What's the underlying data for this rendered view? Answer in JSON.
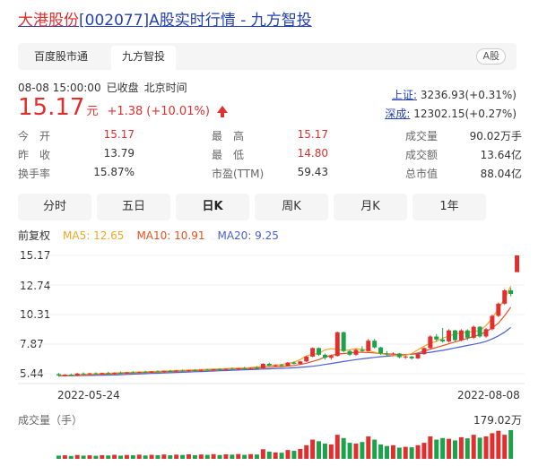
{
  "title": {
    "name": "大港股份",
    "code": "[002077]",
    "suffix": "A股实时行情 - 九方智投"
  },
  "tabs": [
    {
      "label": "百度股市通",
      "active": false
    },
    {
      "label": "九方智投",
      "active": true
    }
  ],
  "market_badge": "A股",
  "status": {
    "datetime": "08-08 15:00:00",
    "state": "已收盘",
    "timezone": "北京时间"
  },
  "quote": {
    "price": "15.17",
    "unit": "元",
    "change": "+1.38",
    "change_pct": "(+10.01%)",
    "direction": "up"
  },
  "indices": [
    {
      "name": "上证:",
      "value": "3236.93(+0.31%)"
    },
    {
      "name": "深成:",
      "value": "12302.15(+0.27%)"
    }
  ],
  "stats": [
    {
      "label": "今　开",
      "value": "15.17",
      "color": "red"
    },
    {
      "label": "最　高",
      "value": "15.17",
      "color": "red"
    },
    {
      "label": "成交量",
      "value": "90.02万手",
      "color": "normal"
    },
    {
      "label": "昨　收",
      "value": "13.79",
      "color": "normal"
    },
    {
      "label": "最　低",
      "value": "14.80",
      "color": "red"
    },
    {
      "label": "成交额",
      "value": "13.64亿",
      "color": "normal"
    },
    {
      "label": "换手率",
      "value": "15.87%",
      "color": "normal"
    },
    {
      "label": "市盈(TTM)",
      "value": "59.43",
      "color": "normal"
    },
    {
      "label": "总市值",
      "value": "88.04亿",
      "color": "normal"
    }
  ],
  "period_tabs": [
    {
      "label": "分时",
      "active": false
    },
    {
      "label": "五日",
      "active": false
    },
    {
      "label": "日K",
      "active": true
    },
    {
      "label": "周K",
      "active": false
    },
    {
      "label": "月K",
      "active": false
    },
    {
      "label": "1年",
      "active": false
    }
  ],
  "legend": {
    "adjust": "前复权",
    "ma5": "MA5: 12.65",
    "ma10": "MA10: 10.91",
    "ma20": "MA20: 9.25"
  },
  "colors": {
    "up": "#e12e2e",
    "down": "#1aa34a",
    "ma5": "#f5a623",
    "ma10": "#e8501e",
    "ma20": "#4a5fd8",
    "link": "#2440b3"
  },
  "chart_data": {
    "type": "candlestick",
    "y_ticks": [
      "15.17",
      "12.74",
      "10.31",
      "7.87",
      "5.44"
    ],
    "ylim": [
      5.44,
      15.17
    ],
    "x_labels": [
      "2022-05-24",
      "2022-08-08"
    ],
    "volume_label": "成交量（手）",
    "volume_max_label": "179.02万",
    "candles": [
      {
        "o": 5.4,
        "h": 5.5,
        "l": 5.2,
        "c": 5.3
      },
      {
        "o": 5.3,
        "h": 5.4,
        "l": 5.2,
        "c": 5.35
      },
      {
        "o": 5.35,
        "h": 5.45,
        "l": 5.25,
        "c": 5.3
      },
      {
        "o": 5.3,
        "h": 5.5,
        "l": 5.25,
        "c": 5.45
      },
      {
        "o": 5.45,
        "h": 5.55,
        "l": 5.35,
        "c": 5.4
      },
      {
        "o": 5.4,
        "h": 5.5,
        "l": 5.3,
        "c": 5.48
      },
      {
        "o": 5.48,
        "h": 5.55,
        "l": 5.38,
        "c": 5.42
      },
      {
        "o": 5.42,
        "h": 5.52,
        "l": 5.35,
        "c": 5.5
      },
      {
        "o": 5.5,
        "h": 5.6,
        "l": 5.42,
        "c": 5.45
      },
      {
        "o": 5.45,
        "h": 5.55,
        "l": 5.38,
        "c": 5.52
      },
      {
        "o": 5.52,
        "h": 5.62,
        "l": 5.45,
        "c": 5.48
      },
      {
        "o": 5.48,
        "h": 5.58,
        "l": 5.4,
        "c": 5.55
      },
      {
        "o": 5.55,
        "h": 5.65,
        "l": 5.48,
        "c": 5.5
      },
      {
        "o": 5.5,
        "h": 5.6,
        "l": 5.45,
        "c": 5.58
      },
      {
        "o": 5.58,
        "h": 5.68,
        "l": 5.5,
        "c": 5.55
      },
      {
        "o": 5.55,
        "h": 5.65,
        "l": 5.48,
        "c": 5.62
      },
      {
        "o": 5.62,
        "h": 5.72,
        "l": 5.55,
        "c": 5.58
      },
      {
        "o": 5.58,
        "h": 5.7,
        "l": 5.52,
        "c": 5.66
      },
      {
        "o": 5.66,
        "h": 5.75,
        "l": 5.58,
        "c": 5.62
      },
      {
        "o": 5.62,
        "h": 5.74,
        "l": 5.55,
        "c": 5.7
      },
      {
        "o": 5.7,
        "h": 5.78,
        "l": 5.6,
        "c": 5.65
      },
      {
        "o": 5.65,
        "h": 5.75,
        "l": 5.58,
        "c": 5.72
      },
      {
        "o": 5.72,
        "h": 5.8,
        "l": 5.64,
        "c": 5.68
      },
      {
        "o": 5.68,
        "h": 5.8,
        "l": 5.62,
        "c": 5.76
      },
      {
        "o": 5.76,
        "h": 5.85,
        "l": 5.68,
        "c": 5.72
      },
      {
        "o": 5.72,
        "h": 5.84,
        "l": 5.66,
        "c": 5.8
      },
      {
        "o": 5.8,
        "h": 5.9,
        "l": 5.72,
        "c": 5.76
      },
      {
        "o": 5.76,
        "h": 5.88,
        "l": 5.7,
        "c": 5.84
      },
      {
        "o": 5.84,
        "h": 5.95,
        "l": 5.76,
        "c": 5.8
      },
      {
        "o": 5.8,
        "h": 5.92,
        "l": 5.74,
        "c": 5.88
      },
      {
        "o": 5.88,
        "h": 6.0,
        "l": 5.8,
        "c": 5.84
      },
      {
        "o": 5.84,
        "h": 5.96,
        "l": 5.78,
        "c": 5.92
      },
      {
        "o": 5.92,
        "h": 6.05,
        "l": 5.85,
        "c": 5.88
      },
      {
        "o": 5.88,
        "h": 6.3,
        "l": 5.85,
        "c": 6.25
      },
      {
        "o": 6.25,
        "h": 6.35,
        "l": 6.05,
        "c": 6.1
      },
      {
        "o": 6.1,
        "h": 6.2,
        "l": 6.0,
        "c": 6.15
      },
      {
        "o": 6.15,
        "h": 6.25,
        "l": 6.05,
        "c": 6.1
      },
      {
        "o": 6.1,
        "h": 6.4,
        "l": 6.05,
        "c": 6.35
      },
      {
        "o": 6.35,
        "h": 6.45,
        "l": 6.2,
        "c": 6.25
      },
      {
        "o": 6.25,
        "h": 6.5,
        "l": 6.2,
        "c": 6.45
      },
      {
        "o": 6.45,
        "h": 6.9,
        "l": 6.4,
        "c": 6.85
      },
      {
        "o": 6.85,
        "h": 7.6,
        "l": 6.8,
        "c": 7.55
      },
      {
        "o": 7.55,
        "h": 7.6,
        "l": 6.9,
        "c": 7.0
      },
      {
        "o": 7.0,
        "h": 7.1,
        "l": 6.6,
        "c": 6.75
      },
      {
        "o": 6.75,
        "h": 7.0,
        "l": 6.6,
        "c": 6.9
      },
      {
        "o": 6.9,
        "h": 8.9,
        "l": 6.85,
        "c": 8.85
      },
      {
        "o": 8.85,
        "h": 8.9,
        "l": 7.2,
        "c": 7.3
      },
      {
        "o": 7.3,
        "h": 7.4,
        "l": 6.9,
        "c": 7.0
      },
      {
        "o": 7.0,
        "h": 7.5,
        "l": 6.9,
        "c": 7.4
      },
      {
        "o": 7.4,
        "h": 7.7,
        "l": 7.2,
        "c": 7.3
      },
      {
        "o": 7.3,
        "h": 8.3,
        "l": 7.25,
        "c": 8.15
      },
      {
        "o": 8.15,
        "h": 8.3,
        "l": 7.5,
        "c": 7.6
      },
      {
        "o": 7.6,
        "h": 7.65,
        "l": 7.0,
        "c": 7.1
      },
      {
        "o": 7.1,
        "h": 7.3,
        "l": 6.9,
        "c": 7.05
      },
      {
        "o": 7.05,
        "h": 7.2,
        "l": 6.95,
        "c": 7.1
      },
      {
        "o": 7.1,
        "h": 7.15,
        "l": 6.7,
        "c": 6.8
      },
      {
        "o": 6.8,
        "h": 6.95,
        "l": 6.65,
        "c": 6.85
      },
      {
        "o": 6.85,
        "h": 6.9,
        "l": 6.6,
        "c": 6.7
      },
      {
        "o": 6.7,
        "h": 7.1,
        "l": 6.65,
        "c": 7.05
      },
      {
        "o": 7.05,
        "h": 7.6,
        "l": 7.0,
        "c": 7.55
      },
      {
        "o": 7.55,
        "h": 8.6,
        "l": 7.5,
        "c": 8.5
      },
      {
        "o": 8.5,
        "h": 8.7,
        "l": 8.1,
        "c": 8.25
      },
      {
        "o": 8.25,
        "h": 9.2,
        "l": 8.0,
        "c": 8.1
      },
      {
        "o": 8.1,
        "h": 9.1,
        "l": 8.0,
        "c": 9.0
      },
      {
        "o": 9.0,
        "h": 9.05,
        "l": 8.1,
        "c": 8.2
      },
      {
        "o": 8.2,
        "h": 9.1,
        "l": 8.1,
        "c": 9.0
      },
      {
        "o": 9.0,
        "h": 9.1,
        "l": 8.2,
        "c": 8.4
      },
      {
        "o": 8.4,
        "h": 9.4,
        "l": 8.3,
        "c": 9.3
      },
      {
        "o": 9.3,
        "h": 9.35,
        "l": 8.4,
        "c": 8.5
      },
      {
        "o": 8.5,
        "h": 9.2,
        "l": 8.4,
        "c": 9.1
      },
      {
        "o": 9.1,
        "h": 10.3,
        "l": 9.0,
        "c": 10.2
      },
      {
        "o": 10.2,
        "h": 11.3,
        "l": 10.1,
        "c": 11.2
      },
      {
        "o": 11.2,
        "h": 12.4,
        "l": 11.1,
        "c": 12.3
      },
      {
        "o": 12.3,
        "h": 12.5,
        "l": 11.8,
        "c": 12.0
      },
      {
        "o": 13.79,
        "h": 15.17,
        "l": 14.8,
        "c": 15.17
      }
    ],
    "ma5": [
      5.3,
      5.32,
      5.33,
      5.36,
      5.38,
      5.4,
      5.42,
      5.45,
      5.47,
      5.5,
      5.52,
      5.54,
      5.56,
      5.58,
      5.6,
      5.62,
      5.64,
      5.66,
      5.68,
      5.7,
      5.72,
      5.74,
      5.76,
      5.78,
      5.8,
      5.82,
      5.84,
      5.86,
      5.88,
      5.9,
      5.92,
      5.94,
      6.0,
      6.05,
      6.1,
      6.15,
      6.2,
      6.28,
      6.4,
      6.6,
      6.9,
      7.05,
      7.1,
      7.4,
      7.5,
      7.45,
      7.35,
      7.4,
      7.5,
      7.45,
      7.35,
      7.2,
      7.1,
      7.0,
      6.95,
      6.9,
      6.95,
      7.1,
      7.4,
      7.7,
      7.95,
      8.1,
      8.35,
      8.55,
      8.7,
      8.8,
      8.85,
      8.9,
      9.0,
      9.4,
      10.0,
      10.8,
      11.6,
      12.65
    ],
    "ma10": [
      5.28,
      5.3,
      5.31,
      5.32,
      5.34,
      5.36,
      5.38,
      5.4,
      5.42,
      5.44,
      5.46,
      5.48,
      5.5,
      5.52,
      5.54,
      5.56,
      5.58,
      5.6,
      5.62,
      5.64,
      5.66,
      5.68,
      5.7,
      5.72,
      5.74,
      5.76,
      5.78,
      5.8,
      5.82,
      5.84,
      5.86,
      5.88,
      5.91,
      5.94,
      5.97,
      6.0,
      6.03,
      6.07,
      6.12,
      6.2,
      6.3,
      6.45,
      6.6,
      6.8,
      6.95,
      7.05,
      7.1,
      7.15,
      7.2,
      7.2,
      7.18,
      7.15,
      7.1,
      7.08,
      7.05,
      7.02,
      7.0,
      7.05,
      7.15,
      7.3,
      7.45,
      7.6,
      7.75,
      7.9,
      8.05,
      8.2,
      8.35,
      8.5,
      8.65,
      8.9,
      9.2,
      9.6,
      10.2,
      10.91
    ],
    "ma20": [
      5.25,
      5.26,
      5.27,
      5.28,
      5.29,
      5.3,
      5.31,
      5.32,
      5.33,
      5.34,
      5.36,
      5.38,
      5.4,
      5.42,
      5.44,
      5.46,
      5.48,
      5.5,
      5.52,
      5.54,
      5.56,
      5.58,
      5.6,
      5.62,
      5.64,
      5.66,
      5.68,
      5.7,
      5.72,
      5.74,
      5.76,
      5.78,
      5.8,
      5.82,
      5.84,
      5.86,
      5.88,
      5.9,
      5.93,
      5.96,
      6.0,
      6.05,
      6.12,
      6.2,
      6.28,
      6.36,
      6.44,
      6.52,
      6.6,
      6.66,
      6.72,
      6.78,
      6.84,
      6.88,
      6.92,
      6.96,
      7.0,
      7.04,
      7.08,
      7.14,
      7.2,
      7.28,
      7.36,
      7.46,
      7.56,
      7.66,
      7.76,
      7.86,
      7.96,
      8.1,
      8.3,
      8.55,
      8.85,
      9.25
    ],
    "volume": [
      20,
      22,
      18,
      24,
      20,
      22,
      19,
      23,
      21,
      25,
      20,
      24,
      22,
      26,
      21,
      25,
      23,
      27,
      22,
      26,
      24,
      28,
      23,
      27,
      25,
      29,
      24,
      28,
      26,
      30,
      25,
      29,
      27,
      60,
      45,
      40,
      38,
      55,
      50,
      62,
      85,
      120,
      110,
      95,
      90,
      150,
      130,
      100,
      95,
      105,
      140,
      120,
      90,
      80,
      85,
      70,
      75,
      72,
      85,
      100,
      140,
      120,
      130,
      125,
      115,
      135,
      128,
      150,
      132,
      140,
      160,
      175,
      150,
      179.02
    ]
  }
}
